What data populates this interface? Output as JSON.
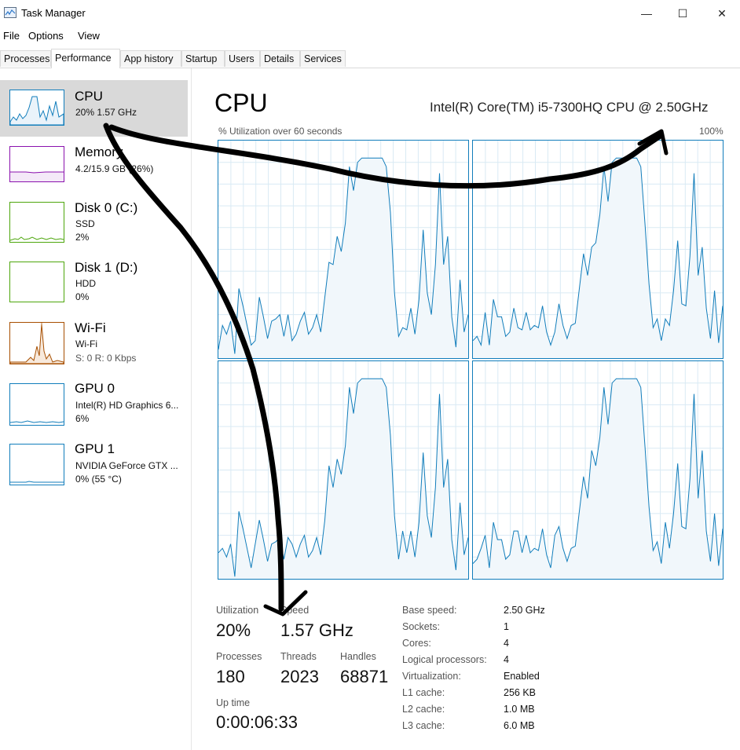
{
  "window": {
    "title": "Task Manager",
    "controls": [
      "—",
      "☐",
      "✕"
    ]
  },
  "menu": [
    "File",
    "Options",
    "View"
  ],
  "tabs": [
    "Processes",
    "Performance",
    "App history",
    "Startup",
    "Users",
    "Details",
    "Services"
  ],
  "active_tab": "Performance",
  "sidebar": [
    {
      "name": "CPU",
      "line1": "20%  1.57 GHz",
      "line2": "",
      "color": "#117dbb",
      "selected": true
    },
    {
      "name": "Memory",
      "line1": "4.2/15.9 GB (26%)",
      "line2": "",
      "color": "#8b12ae",
      "selected": false
    },
    {
      "name": "Disk 0 (C:)",
      "line1": "SSD",
      "line2": "2%",
      "color": "#4da60c",
      "selected": false
    },
    {
      "name": "Disk 1 (D:)",
      "line1": "HDD",
      "line2": "0%",
      "color": "#4da60c",
      "selected": false
    },
    {
      "name": "Wi-Fi",
      "line1": "Wi-Fi",
      "line2": "S: 0  R: 0 Kbps",
      "color": "#a74f01",
      "selected": false
    },
    {
      "name": "GPU 0",
      "line1": "Intel(R) HD Graphics 6...",
      "line2": "6%",
      "color": "#117dbb",
      "selected": false
    },
    {
      "name": "GPU 1",
      "line1": "NVIDIA GeForce GTX ...",
      "line2": "0%  (55 °C)",
      "color": "#117dbb",
      "selected": false
    }
  ],
  "main": {
    "title": "CPU",
    "model": "Intel(R) Core(TM) i5-7300HQ CPU @ 2.50GHz",
    "graph_label": "% Utilization over 60 seconds",
    "graph_max": "100%",
    "graph_color": "#117dbb",
    "core_count": 4
  },
  "stats": {
    "utilization_label": "Utilization",
    "utilization": "20%",
    "speed_label": "Speed",
    "speed": "1.57 GHz",
    "processes_label": "Processes",
    "processes": "180",
    "threads_label": "Threads",
    "threads": "2023",
    "handles_label": "Handles",
    "handles": "68871",
    "uptime_label": "Up time",
    "uptime": "0:00:06:33"
  },
  "details": [
    {
      "label": "Base speed:",
      "value": "2.50 GHz"
    },
    {
      "label": "Sockets:",
      "value": "1"
    },
    {
      "label": "Cores:",
      "value": "4"
    },
    {
      "label": "Logical processors:",
      "value": "4"
    },
    {
      "label": "Virtualization:",
      "value": "Enabled"
    },
    {
      "label": "L1 cache:",
      "value": "256 KB"
    },
    {
      "label": "L2 cache:",
      "value": "1.0 MB"
    },
    {
      "label": "L3 cache:",
      "value": "6.0 MB"
    }
  ],
  "cpu_history": [
    8,
    12,
    10,
    18,
    5,
    28,
    22,
    15,
    8,
    12,
    25,
    18,
    10,
    20,
    14,
    18,
    10,
    22,
    12,
    8,
    16,
    22,
    14,
    10,
    18,
    12,
    30,
    48,
    40,
    55,
    50,
    65,
    88,
    75,
    90,
    92,
    92,
    92,
    92,
    92,
    92,
    88,
    65,
    30,
    12,
    18,
    10,
    22,
    12,
    30,
    55,
    28,
    20,
    45,
    85,
    40,
    55,
    20,
    8,
    32,
    10,
    20
  ]
}
